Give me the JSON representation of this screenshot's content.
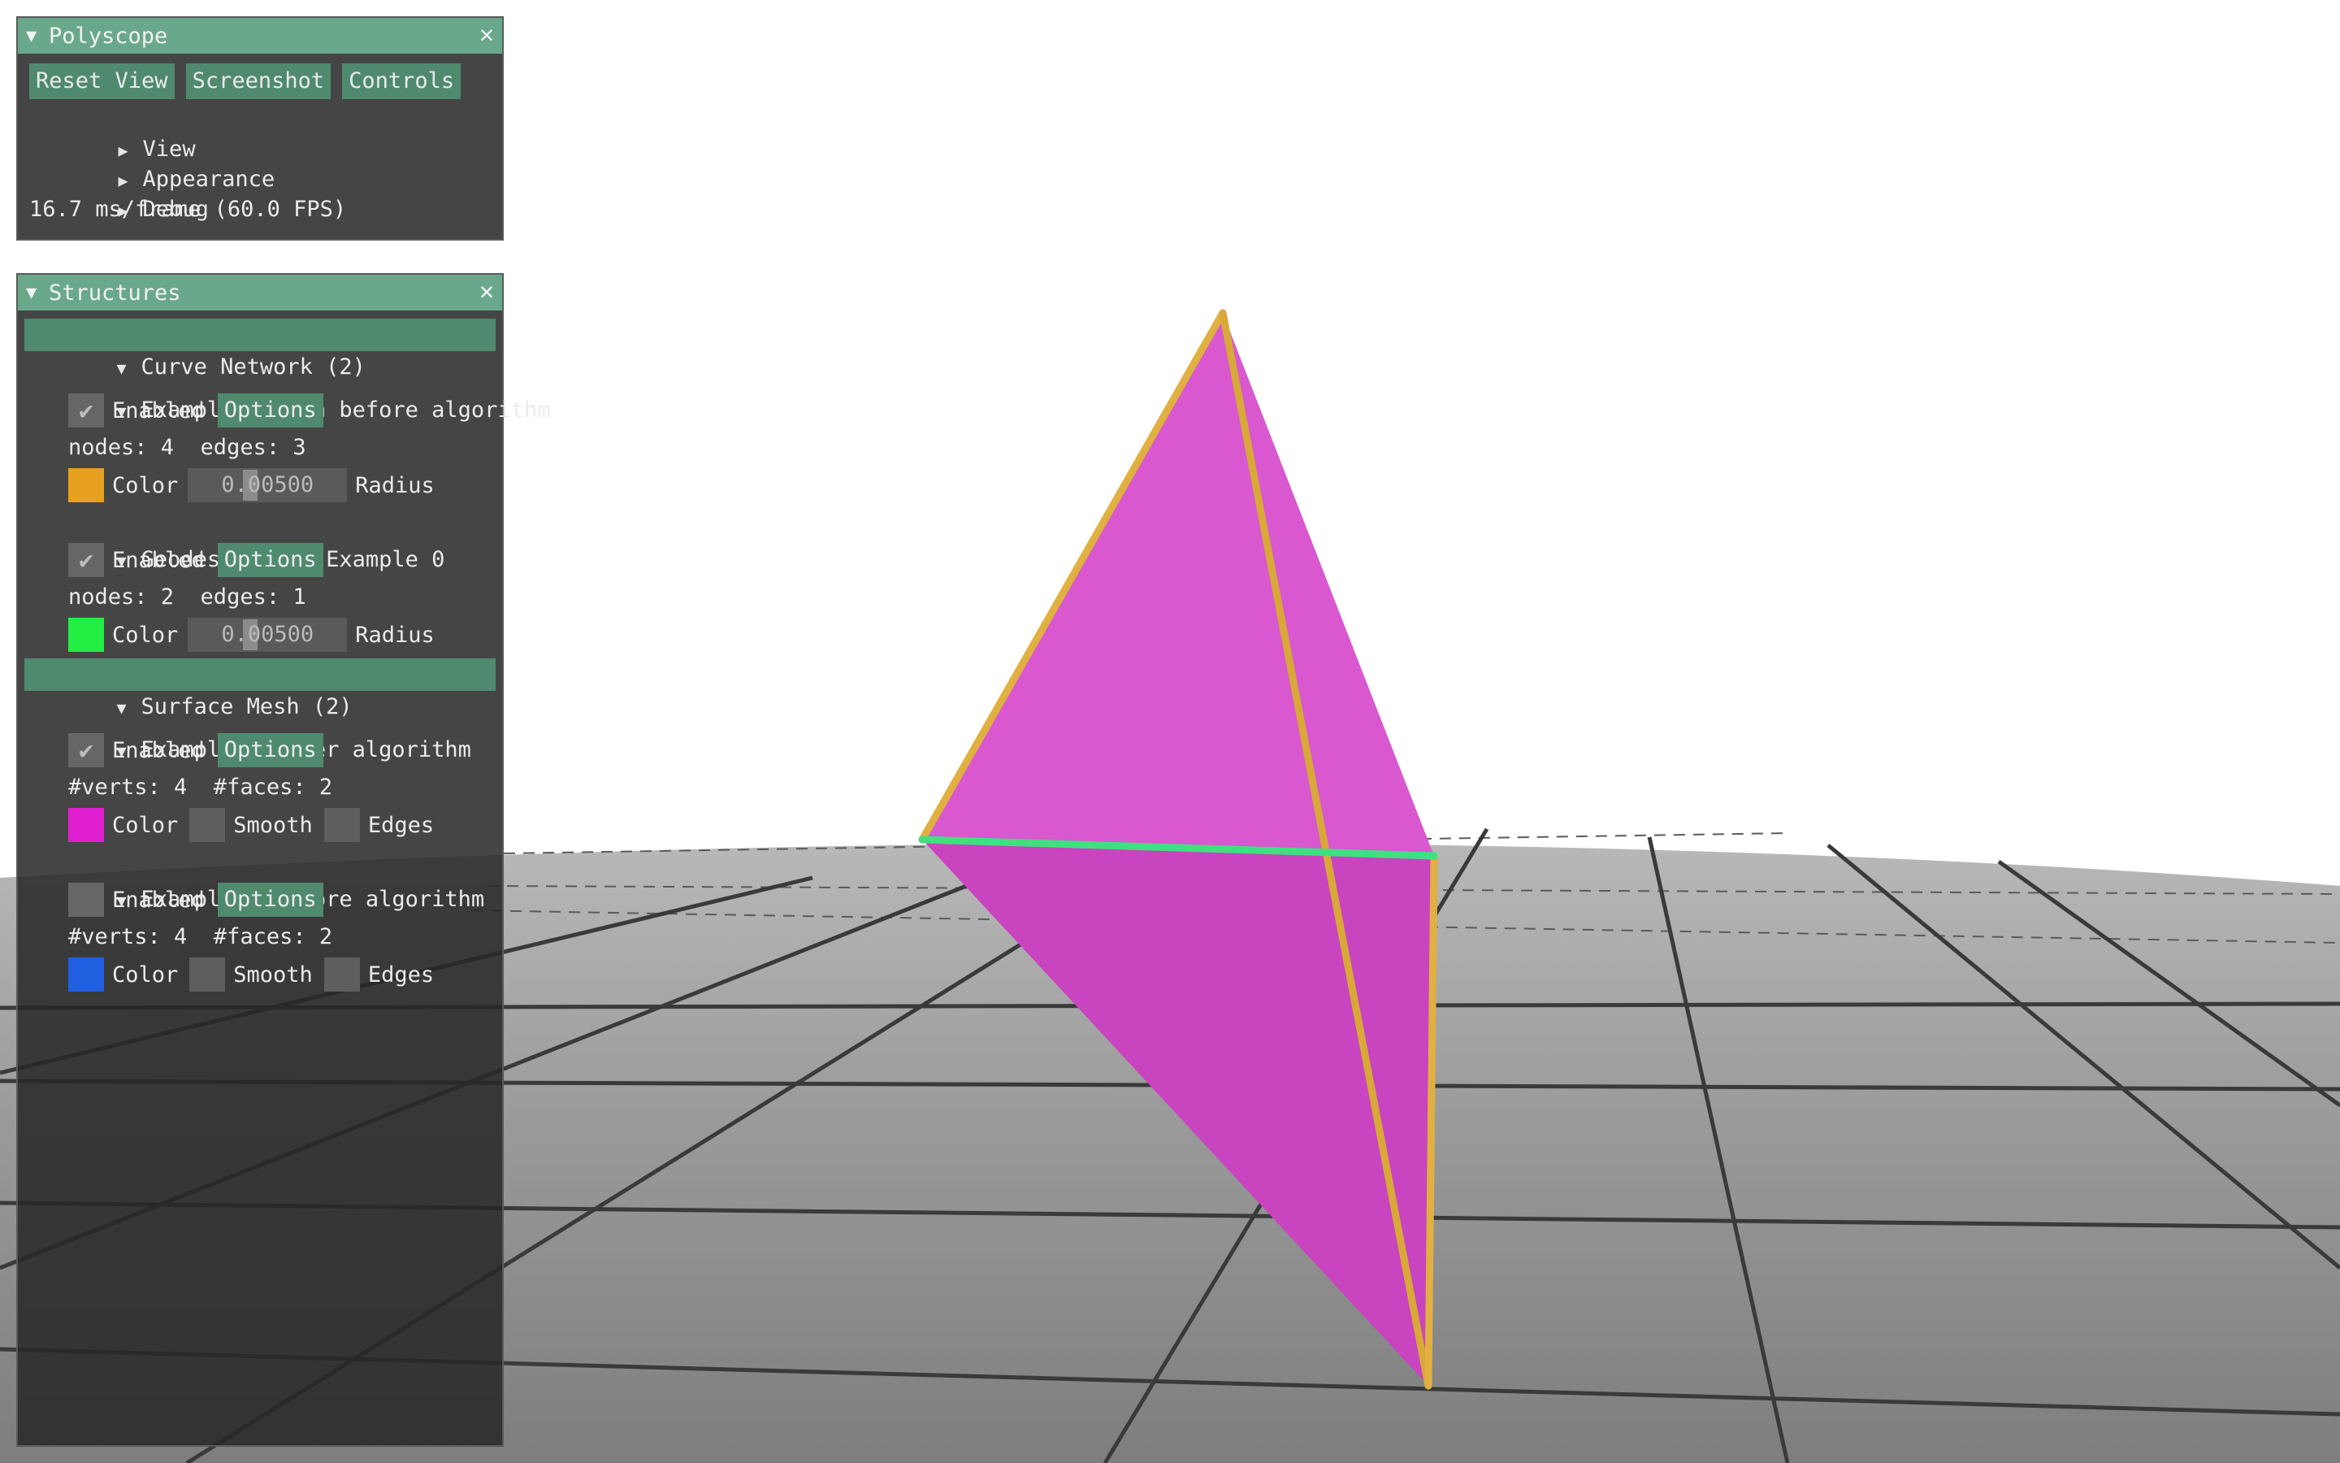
{
  "polyscope_panel": {
    "title": "Polyscope",
    "buttons": {
      "reset_view": "Reset View",
      "screenshot": "Screenshot",
      "controls": "Controls"
    },
    "tree": [
      {
        "label": "View"
      },
      {
        "label": "Appearance"
      },
      {
        "label": "Debug"
      }
    ],
    "fps_text": "16.7 ms/frame (60.0 FPS)",
    "close_glyph": "✕",
    "collapse_glyph": "▼",
    "expand_glyph": "▶"
  },
  "structures_panel": {
    "title": "Structures",
    "close_glyph": "✕",
    "curve_network_header": "Curve Network (2)",
    "surface_mesh_header": "Surface Mesh (2)",
    "curves": [
      {
        "name": "Example 0 path before algorithm",
        "enabled": true,
        "enabled_label": "Enabled",
        "options_label": "Options",
        "info": "nodes: 4  edges: 3",
        "color": "#e8a020",
        "color_label": "Color",
        "radius": "0.00500",
        "radius_label": "Radius"
      },
      {
        "name": "Geodesic path Example 0",
        "enabled": true,
        "enabled_label": "Enabled",
        "options_label": "Options",
        "info": "nodes: 2  edges: 1",
        "color": "#22ee44",
        "color_label": "Color",
        "radius": "0.00500",
        "radius_label": "Radius"
      }
    ],
    "meshes": [
      {
        "name": "Example 0 after algorithm",
        "enabled": true,
        "enabled_label": "Enabled",
        "options_label": "Options",
        "info": "#verts: 4  #faces: 2",
        "color": "#e020d0",
        "color_label": "Color",
        "smooth_label": "Smooth",
        "edges_label": "Edges"
      },
      {
        "name": "Example 0 before algorithm",
        "enabled": false,
        "enabled_label": "Enabled",
        "options_label": "Options",
        "info": "#verts: 4  #faces: 2",
        "color": "#2060e0",
        "color_label": "Color",
        "smooth_label": "Smooth",
        "edges_label": "Edges"
      }
    ],
    "check_glyph": "✔"
  },
  "scene": {
    "background_color": "#ffffff",
    "ground_color": "#8c8c8c",
    "mesh_face_color": "#d54ccc",
    "curve_color": "#e0b040",
    "geodesic_color": "#3ee080"
  }
}
